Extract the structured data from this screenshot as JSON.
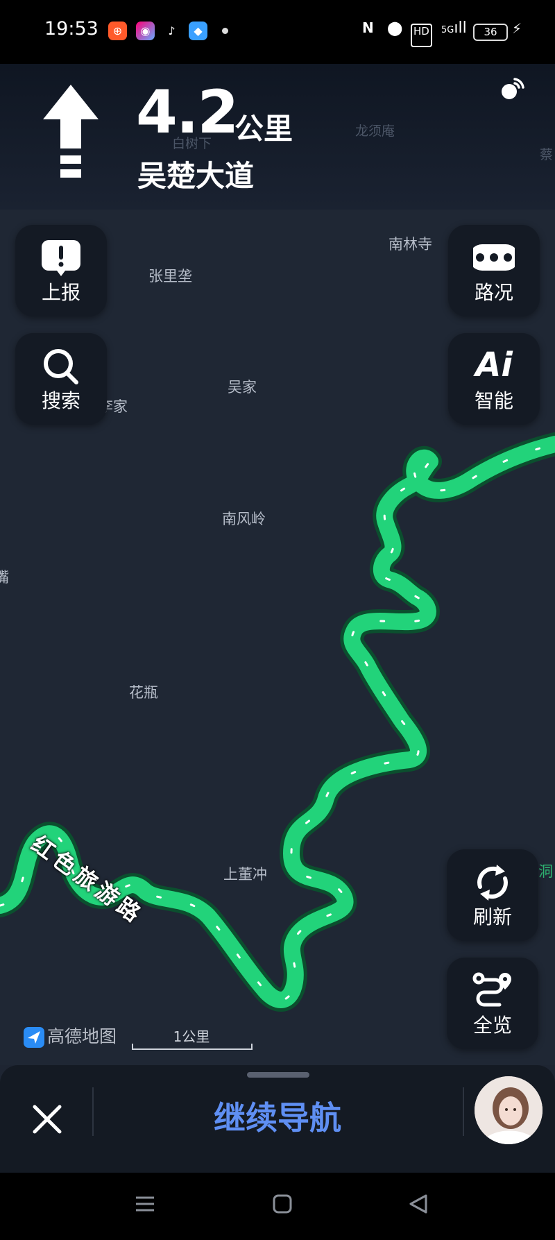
{
  "status_bar": {
    "time": "19:53",
    "apps": [
      "kuaishou-icon",
      "gallery-icon",
      "tiktok-icon",
      "bluebird-icon"
    ],
    "network": "5G",
    "battery": "36"
  },
  "nav": {
    "distance_value": "4.2",
    "distance_unit": "公里",
    "road_name": "吴楚大道",
    "faded_labels": [
      "白树下",
      "龙须庵",
      "蔡"
    ]
  },
  "map": {
    "places": [
      "张里垄",
      "南林寺",
      "吴家",
      "李家",
      "南风岭",
      "花瓶",
      "上董冲",
      "洞",
      "嘴"
    ],
    "route_label": "红色旅游路",
    "route_color": "#22d37a",
    "brand": "高德地图",
    "scale": "1公里"
  },
  "buttons": {
    "report": "上报",
    "search": "搜索",
    "traffic": "路况",
    "ai_icon_text": "Ai",
    "ai": "智能",
    "refresh": "刷新",
    "overview": "全览"
  },
  "bottom": {
    "continue_label": "继续导航"
  }
}
